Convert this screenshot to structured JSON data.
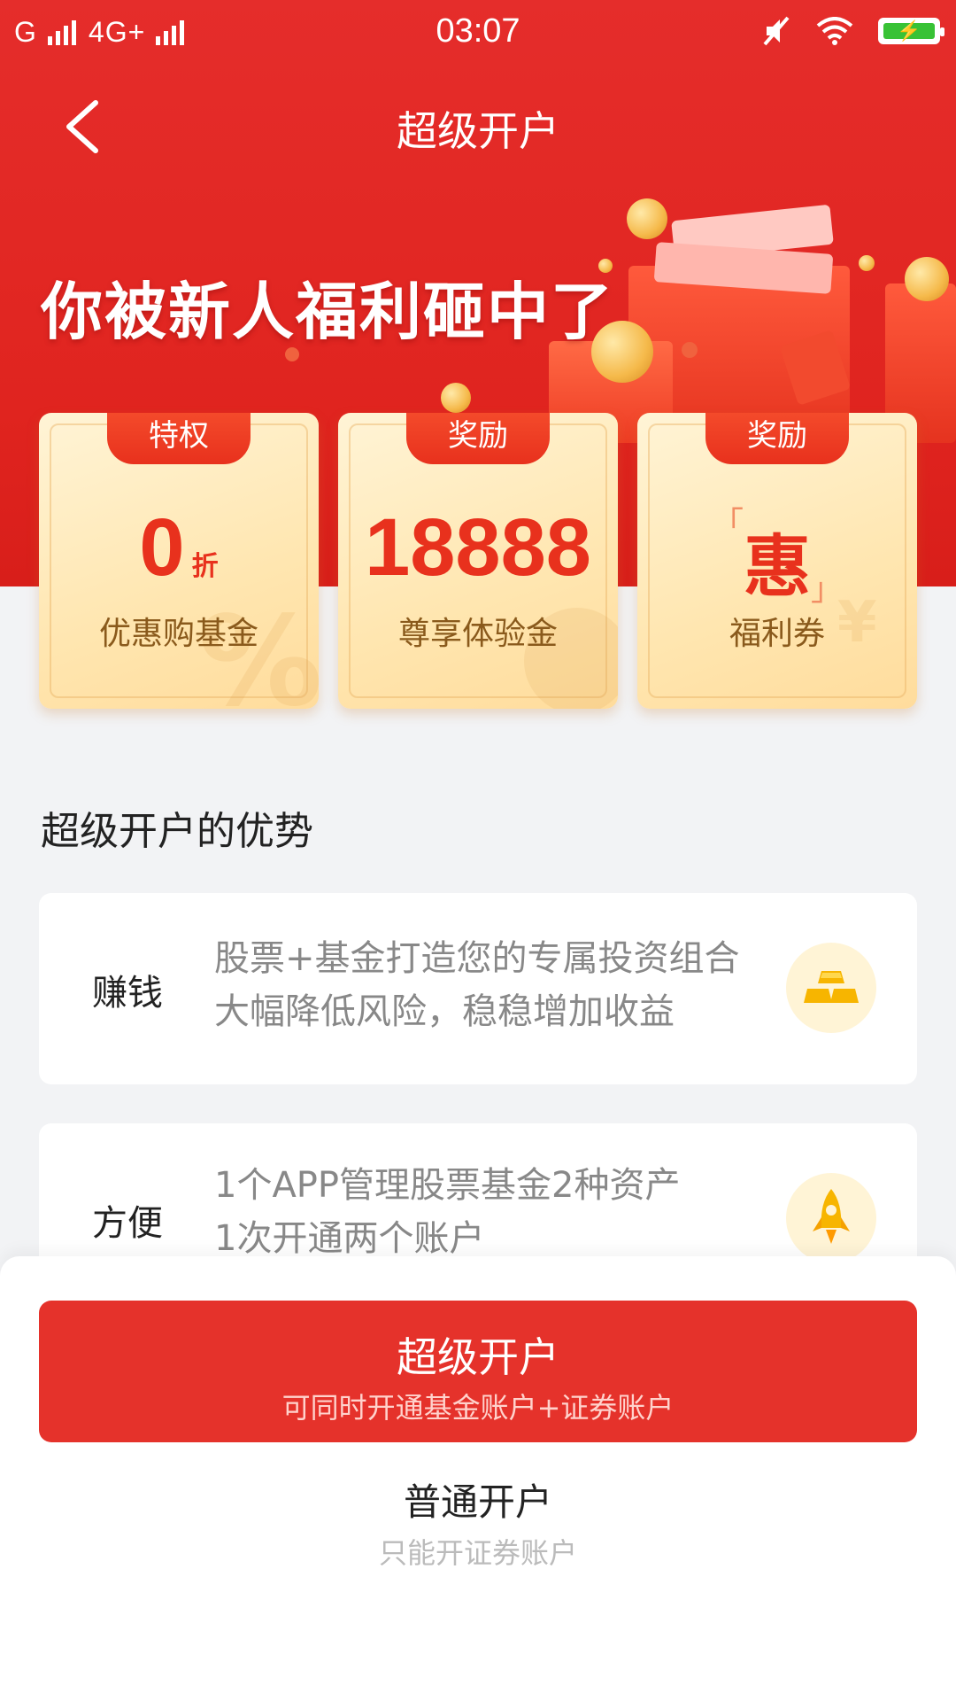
{
  "status_bar": {
    "network_left": "G",
    "network_right": "4G+",
    "time": "03:07"
  },
  "nav": {
    "title": "超级开户"
  },
  "hero": {
    "headline": "你被新人福利砸中了"
  },
  "cards": [
    {
      "tag": "特权",
      "value": "0",
      "unit": "折",
      "label": "优惠购基金"
    },
    {
      "tag": "奖励",
      "value": "18888",
      "label": "尊享体验金"
    },
    {
      "tag": "奖励",
      "value": "惠",
      "label": "福利券"
    }
  ],
  "advantages": {
    "title": "超级开户的优势",
    "items": [
      {
        "label": "赚钱",
        "line1": "股票+基金打造您的专属投资组合",
        "line2": "大幅降低风险，稳稳增加收益",
        "icon": "gold-bars-icon"
      },
      {
        "label": "方便",
        "line1": "1个APP管理股票基金2种资产",
        "line2": "1次开通两个账户",
        "icon": "rocket-icon"
      }
    ]
  },
  "actions": {
    "primary": {
      "title": "超级开户",
      "subtitle": "可同时开通基金账户+证券账户"
    },
    "secondary": {
      "title": "普通开户",
      "subtitle": "只能开证券账户"
    }
  },
  "colors": {
    "brand_red": "#e5322b",
    "card_gold": "#ffe6b0",
    "accent_text": "#e8311d"
  }
}
